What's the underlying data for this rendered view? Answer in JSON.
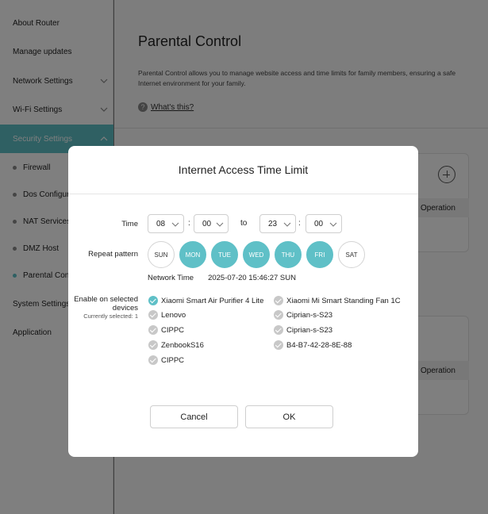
{
  "sidebar": {
    "items": [
      {
        "label": "About Router"
      },
      {
        "label": "Manage updates"
      },
      {
        "label": "Network Settings"
      },
      {
        "label": "Wi-Fi Settings"
      },
      {
        "label": "Security Settings"
      },
      {
        "label": "System Settings"
      },
      {
        "label": "Application"
      }
    ],
    "subitems": [
      {
        "label": "Firewall"
      },
      {
        "label": "Dos Configuration"
      },
      {
        "label": "NAT Services"
      },
      {
        "label": "DMZ Host"
      },
      {
        "label": "Parental Control"
      }
    ]
  },
  "main": {
    "title": "Parental Control",
    "description": "Parental Control allows you to manage website access and time limits for family members, ensuring a safe Internet environment for your family.",
    "whats_this": "What's this?",
    "icon_help": "question-circle-icon",
    "icon_add": "plus-circle-icon",
    "operation_header": "Operation"
  },
  "modal": {
    "title": "Internet Access Time Limit",
    "time_label": "Time",
    "start_hour": "08",
    "start_minute": "00",
    "to_label": "to",
    "end_hour": "23",
    "end_minute": "00",
    "colon": ":",
    "repeat_label": "Repeat pattern",
    "days": [
      {
        "label": "SUN",
        "on": false
      },
      {
        "label": "MON",
        "on": true
      },
      {
        "label": "TUE",
        "on": true
      },
      {
        "label": "WED",
        "on": true
      },
      {
        "label": "THU",
        "on": true
      },
      {
        "label": "FRI",
        "on": true
      },
      {
        "label": "SAT",
        "on": false
      }
    ],
    "network_time_label": "Network Time",
    "network_time_value": "2025-07-20 15:46:27 SUN",
    "enable_label": "Enable on selected devices",
    "currently_selected": "Currently selected: 1",
    "devices_left": [
      {
        "name": "Xiaomi Smart Air Purifier 4 Lite",
        "checked": true
      },
      {
        "name": "Lenovo",
        "checked": false
      },
      {
        "name": "CIPPC",
        "checked": false
      },
      {
        "name": "ZenbookS16",
        "checked": false
      },
      {
        "name": "CIPPC",
        "checked": false
      }
    ],
    "devices_right": [
      {
        "name": "Xiaomi Mi Smart Standing Fan 1C",
        "checked": false
      },
      {
        "name": "Ciprian-s-S23",
        "checked": false
      },
      {
        "name": "Ciprian-s-S23",
        "checked": false
      },
      {
        "name": "B4-B7-42-28-8E-88",
        "checked": false
      }
    ],
    "cancel_label": "Cancel",
    "ok_label": "OK"
  },
  "colors": {
    "accent": "#5fc0c7",
    "overlay": "#000000"
  }
}
